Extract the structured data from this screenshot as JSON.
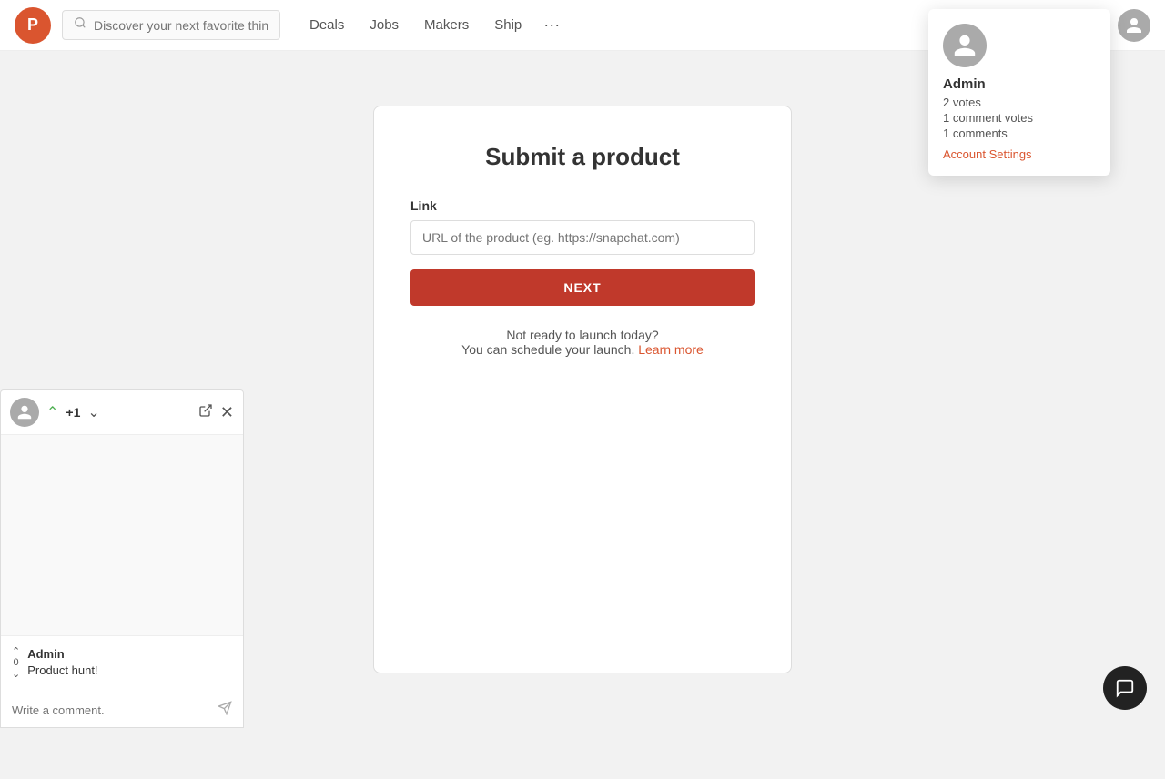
{
  "navbar": {
    "logo_text": "P",
    "search_placeholder": "Discover your next favorite thing...",
    "nav_items": [
      "Deals",
      "Jobs",
      "Makers",
      "Ship"
    ],
    "more_label": "···"
  },
  "dropdown": {
    "username": "Admin",
    "stats": {
      "votes": "2 votes",
      "comment_votes": "1 comment votes",
      "comments": "1 comments"
    },
    "account_settings_label": "Account Settings"
  },
  "main": {
    "title": "Submit a product",
    "form": {
      "link_label": "Link",
      "link_placeholder": "URL of the product (eg. https://snapchat.com)",
      "next_button": "NEXT",
      "not_ready_line1": "Not ready to launch today?",
      "not_ready_line2": "You can schedule your launch.",
      "learn_more": "Learn more"
    }
  },
  "widget": {
    "vote_count": "+1",
    "thread_user": "Admin",
    "thread_title": "Product hunt!",
    "comment_placeholder": "Write a comment.",
    "vote_number": "0"
  }
}
